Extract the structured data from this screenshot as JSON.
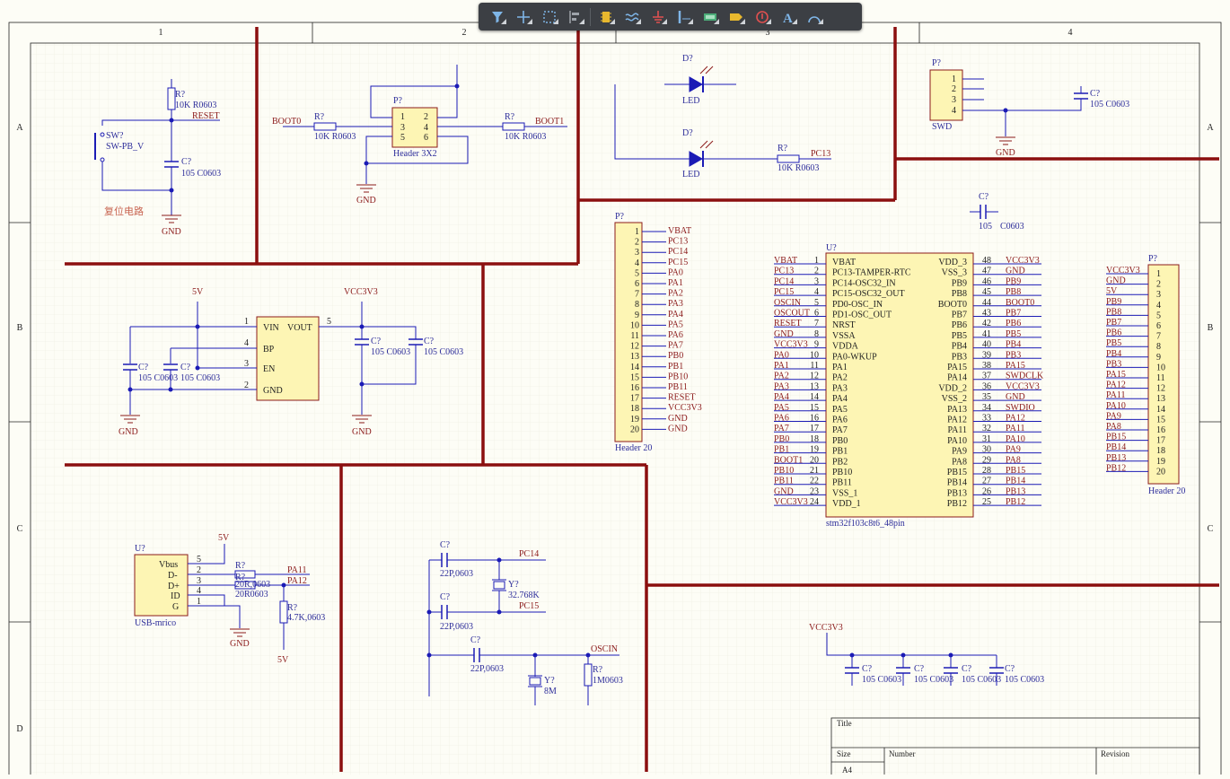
{
  "toolbar": {
    "tools": [
      "filter-icon",
      "crosshair-icon",
      "select-rect-icon",
      "align-icon",
      "component-icon",
      "wire-icon",
      "ground-icon",
      "bus-icon",
      "net-label-icon",
      "port-icon",
      "no-erc-icon",
      "text-icon",
      "arc-icon"
    ]
  },
  "border": {
    "columns": [
      "1",
      "2",
      "3",
      "4"
    ],
    "rows": [
      "A",
      "B",
      "C",
      "D"
    ]
  },
  "title_block": {
    "title": "Title",
    "size": "Size",
    "number": "Number",
    "revision": "Revision",
    "size_value": "A4"
  },
  "reset": {
    "sw_ref": "SW?",
    "sw_name": "SW-PB_V",
    "r_ref": "R?",
    "r_val": "10K R0603",
    "net": "RESET",
    "c_ref": "C?",
    "c_val": "105 C0603",
    "caption": "复位电路",
    "gnd": "GND"
  },
  "boot": {
    "p_ref": "P?",
    "p_name": "Header 3X2",
    "pins": [
      "1",
      "2",
      "3",
      "4",
      "5",
      "6"
    ],
    "r1_ref": "R?",
    "r1_val": "10K R0603",
    "r2_ref": "R?",
    "r2_val": "10K R0603",
    "net0": "BOOT0",
    "net1": "BOOT1",
    "gnd": "GND"
  },
  "leds": {
    "d1_ref": "D?",
    "d1_name": "LED",
    "d2_ref": "D?",
    "d2_name": "LED",
    "r_ref": "R?",
    "r_val": "10K R0603",
    "net": "PC13"
  },
  "swd": {
    "p_ref": "P?",
    "name": "SWD",
    "pins": [
      "1",
      "2",
      "3",
      "4"
    ],
    "c_ref": "C?",
    "c_val": "105 C0603",
    "gnd": "GND"
  },
  "loose_cap": {
    "ref": "C?",
    "val": "C0603"
  },
  "reg": {
    "net5v": "5V",
    "netvcc": "VCC3V3",
    "pins_left": [
      "VIN",
      "BP",
      "EN",
      "GND"
    ],
    "pin_nums_left": [
      "1",
      "4",
      "3",
      "2"
    ],
    "pin_right": "VOUT",
    "pin_num_right": "5",
    "caps": [
      {
        "ref": "C?",
        "val": "105 C0603"
      },
      {
        "ref": "C?",
        "val": "105 C0603"
      },
      {
        "ref": "C?",
        "val": "105 C0603"
      },
      {
        "ref": "C?",
        "val": "105 C0603"
      }
    ],
    "gnd": "GND"
  },
  "hdr_left": {
    "ref": "P?",
    "name": "Header 20",
    "pins": [
      "1",
      "2",
      "3",
      "4",
      "5",
      "6",
      "7",
      "8",
      "9",
      "10",
      "11",
      "12",
      "13",
      "14",
      "15",
      "16",
      "17",
      "18",
      "19",
      "20"
    ],
    "nets": [
      "VBAT",
      "PC13",
      "PC14",
      "PC15",
      "PA0",
      "PA1",
      "PA2",
      "PA3",
      "PA4",
      "PA5",
      "PA6",
      "PA7",
      "PB0",
      "PB1",
      "PB10",
      "PB11",
      "RESET",
      "VCC3V3",
      "GND",
      "GND"
    ]
  },
  "mcu": {
    "ref": "U?",
    "name": "stm32f103c8t6_48pin",
    "left_pins": [
      "VBAT",
      "PC13-TAMPER-RTC",
      "PC14-OSC32_IN",
      "PC15-OSC32_OUT",
      "PD0-OSC_IN",
      "PD1-OSC_OUT",
      "NRST",
      "VSSA",
      "VDDA",
      "PA0-WKUP",
      "PA1",
      "PA2",
      "PA3",
      "PA4",
      "PA5",
      "PA6",
      "PA7",
      "PB0",
      "PB1",
      "PB2",
      "PB10",
      "PB11",
      "VSS_1",
      "VDD_1"
    ],
    "left_nums": [
      "1",
      "2",
      "3",
      "4",
      "5",
      "6",
      "7",
      "8",
      "9",
      "10",
      "11",
      "12",
      "13",
      "14",
      "15",
      "16",
      "17",
      "18",
      "19",
      "20",
      "21",
      "22",
      "23",
      "24"
    ],
    "left_nets": [
      "VBAT",
      "PC13",
      "PC14",
      "PC15",
      "OSCIN",
      "OSCOUT",
      "RESET",
      "GND",
      "VCC3V3",
      "PA0",
      "PA1",
      "PA2",
      "PA3",
      "PA4",
      "PA5",
      "PA6",
      "PA7",
      "PB0",
      "PB1",
      "BOOT1",
      "PB10",
      "PB11",
      "GND",
      "VCC3V3"
    ],
    "right_pins": [
      "VDD_3",
      "VSS_3",
      "PB9",
      "PB8",
      "BOOT0",
      "PB7",
      "PB6",
      "PB5",
      "PB4",
      "PB3",
      "PA15",
      "PA14",
      "VDD_2",
      "VSS_2",
      "PA13",
      "PA12",
      "PA11",
      "PA10",
      "PA9",
      "PA8",
      "PB15",
      "PB14",
      "PB13",
      "PB12"
    ],
    "right_nums": [
      "48",
      "47",
      "46",
      "45",
      "44",
      "43",
      "42",
      "41",
      "40",
      "39",
      "38",
      "37",
      "36",
      "35",
      "34",
      "33",
      "32",
      "31",
      "30",
      "29",
      "28",
      "27",
      "26",
      "25"
    ],
    "right_nets": [
      "VCC3V3",
      "GND",
      "PB9",
      "PB8",
      "BOOT0",
      "PB7",
      "PB6",
      "PB5",
      "PB4",
      "PB3",
      "PA15",
      "SWDCLK",
      "VCC3V3",
      "GND",
      "SWDIO",
      "PA12",
      "PA11",
      "PA10",
      "PA9",
      "PA8",
      "PB15",
      "PB14",
      "PB13",
      "PB12"
    ]
  },
  "hdr_right": {
    "ref": "P?",
    "name": "Header 20",
    "pins": [
      "1",
      "2",
      "3",
      "4",
      "5",
      "6",
      "7",
      "8",
      "9",
      "10",
      "11",
      "12",
      "13",
      "14",
      "15",
      "16",
      "17",
      "18",
      "19",
      "20"
    ],
    "nets": [
      "VCC3V3",
      "GND",
      "5V",
      "PB9",
      "PB8",
      "PB7",
      "PB6",
      "PB5",
      "PB4",
      "PB3",
      "PA15",
      "PA12",
      "PA11",
      "PA10",
      "PA9",
      "PA8",
      "PB15",
      "PB14",
      "PB13",
      "PB12"
    ]
  },
  "usb": {
    "ref": "U?",
    "name": "USB-mrico",
    "pins": [
      "Vbus",
      "D-",
      "D+",
      "ID",
      "G"
    ],
    "pin_nums": [
      "5",
      "2",
      "3",
      "4",
      "1"
    ],
    "net5v": "5V",
    "r1_ref": "R?",
    "r1_val": "20R,0603",
    "r2_ref": "R?",
    "r2_val": "20R0603",
    "r3_ref": "R?",
    "r3_val": "4.7K,0603",
    "pa11": "PA11",
    "pa12": "PA12",
    "gnd": "GND",
    "bottom5v": "5V"
  },
  "crystal": {
    "c1_ref": "C?",
    "c1_val": "22P,0603",
    "c2_ref": "C?",
    "c2_val": "22P,0603",
    "c3_ref": "C?",
    "c3_val": "22P,0603",
    "y1_ref": "Y?",
    "y1_val": "32.768K",
    "y2_ref": "Y?",
    "y2_val": "8M",
    "r_ref": "R?",
    "r_val": "1M0603",
    "pc14": "PC14",
    "pc15": "PC15",
    "oscin": "OSCIN"
  },
  "decoupling": {
    "net": "VCC3V3",
    "caps": [
      {
        "ref": "C?",
        "val": "105 C0603"
      },
      {
        "ref": "C?",
        "val": "105 C0603"
      },
      {
        "ref": "C?",
        "val": "105 C0603"
      },
      {
        "ref": "C?",
        "val": "105 C0603"
      }
    ]
  },
  "colors": {
    "background": "#fdfdf6",
    "wire": "#1b1bb5",
    "net": "#8b1a1a",
    "divider": "#8b0f0f",
    "part_fill": "#fdf5b4",
    "text": "#2d2d9a",
    "toolbar": "#3c3f44",
    "caption": "#c86450"
  }
}
